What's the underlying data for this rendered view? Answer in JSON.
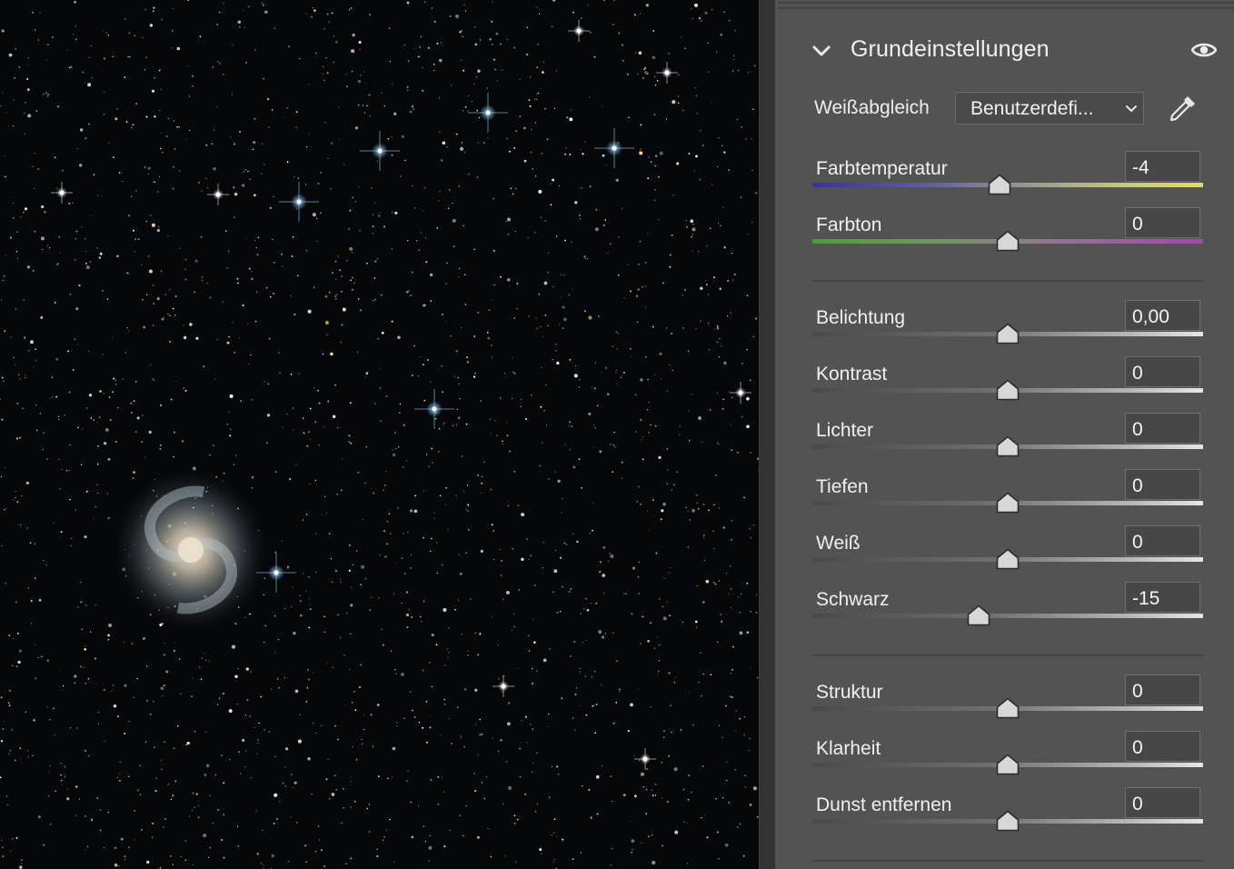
{
  "panel": {
    "section_title": "Grundeinstellungen",
    "white_balance": {
      "label": "Weißabgleich",
      "value": "Benutzerdefi..."
    },
    "groups": [
      [
        {
          "id": "farbtemperatur",
          "label": "Farbtemperatur",
          "value": "-4",
          "fraction": 0.48,
          "track": "temp"
        },
        {
          "id": "farbton",
          "label": "Farbton",
          "value": "0",
          "fraction": 0.5,
          "track": "tint"
        }
      ],
      [
        {
          "id": "belichtung",
          "label": "Belichtung",
          "value": "0,00",
          "fraction": 0.5,
          "track": "gray"
        },
        {
          "id": "kontrast",
          "label": "Kontrast",
          "value": "0",
          "fraction": 0.5,
          "track": "gray"
        },
        {
          "id": "lichter",
          "label": "Lichter",
          "value": "0",
          "fraction": 0.5,
          "track": "gray"
        },
        {
          "id": "tiefen",
          "label": "Tiefen",
          "value": "0",
          "fraction": 0.5,
          "track": "gray"
        },
        {
          "id": "weiss",
          "label": "Weiß",
          "value": "0",
          "fraction": 0.5,
          "track": "gray"
        },
        {
          "id": "schwarz",
          "label": "Schwarz",
          "value": "-15",
          "fraction": 0.425,
          "track": "gray"
        }
      ],
      [
        {
          "id": "struktur",
          "label": "Struktur",
          "value": "0",
          "fraction": 0.5,
          "track": "gray"
        },
        {
          "id": "klarheit",
          "label": "Klarheit",
          "value": "0",
          "fraction": 0.5,
          "track": "gray"
        },
        {
          "id": "dunst-entfernen",
          "label": "Dunst entfernen",
          "value": "0",
          "fraction": 0.5,
          "track": "gray"
        }
      ]
    ]
  },
  "colors": {
    "panel_bg": "#535353",
    "canvas_bg": "#060709",
    "text": "#f0f0f0"
  },
  "icons": {
    "collapse": "chevron-down-icon",
    "visibility": "eye-icon",
    "dropdown": "chevron-down-icon",
    "sampler": "eyedropper-icon"
  }
}
